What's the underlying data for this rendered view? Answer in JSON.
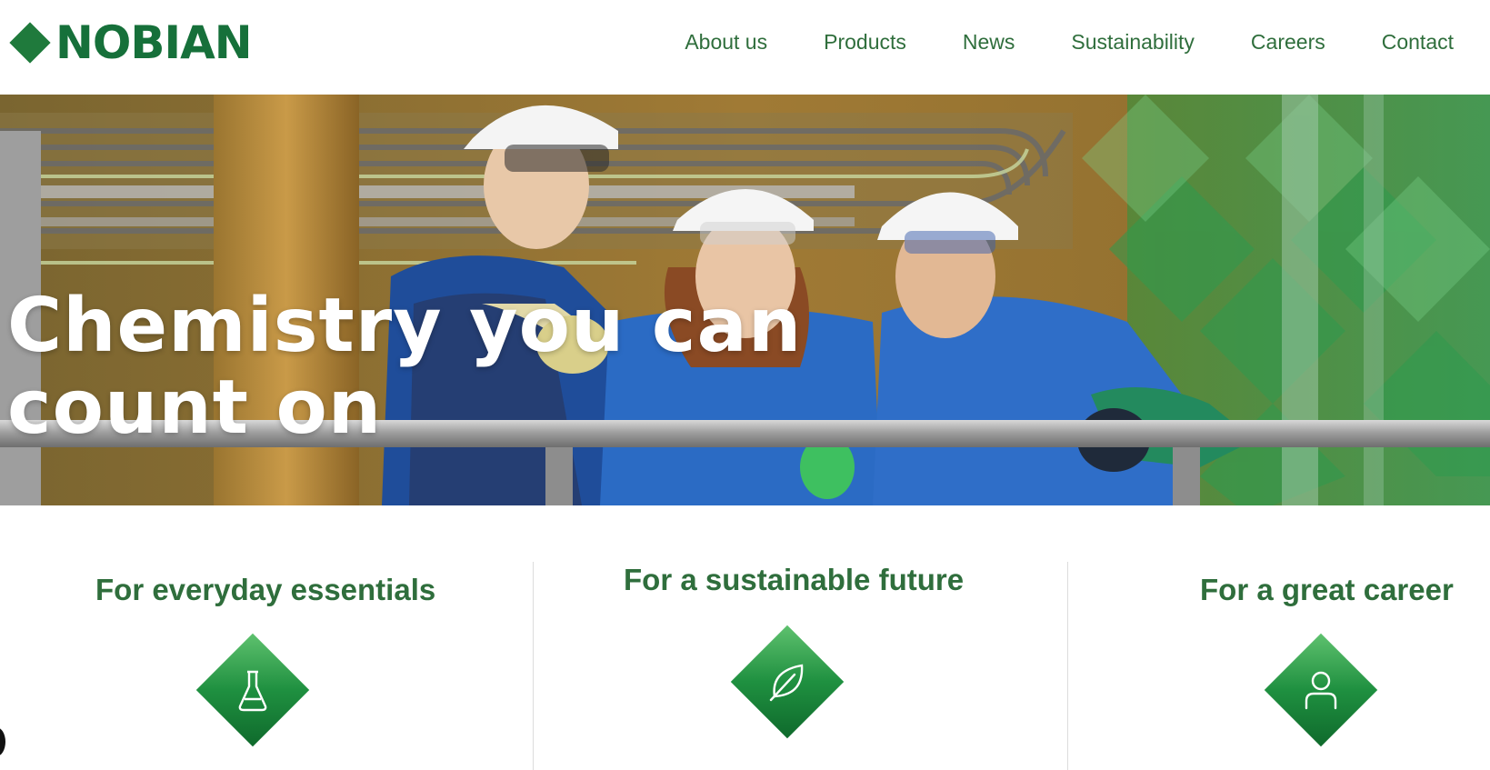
{
  "header": {
    "logo_text": "NOBIAN",
    "nav": [
      "About us",
      "Products",
      "News",
      "Sustainability",
      "Careers",
      "Contact"
    ]
  },
  "hero": {
    "title_line1": "Chemistry you can",
    "title_line2": "count on"
  },
  "features": [
    {
      "title": "For everyday essentials",
      "icon": "flask-icon"
    },
    {
      "title": "For a sustainable future",
      "icon": "leaf-icon"
    },
    {
      "title": "For a great career",
      "icon": "person-icon"
    }
  ],
  "colors": {
    "brand_green": "#16703a",
    "text_green": "#2f6e3c",
    "badge_green": "#1f9040"
  }
}
